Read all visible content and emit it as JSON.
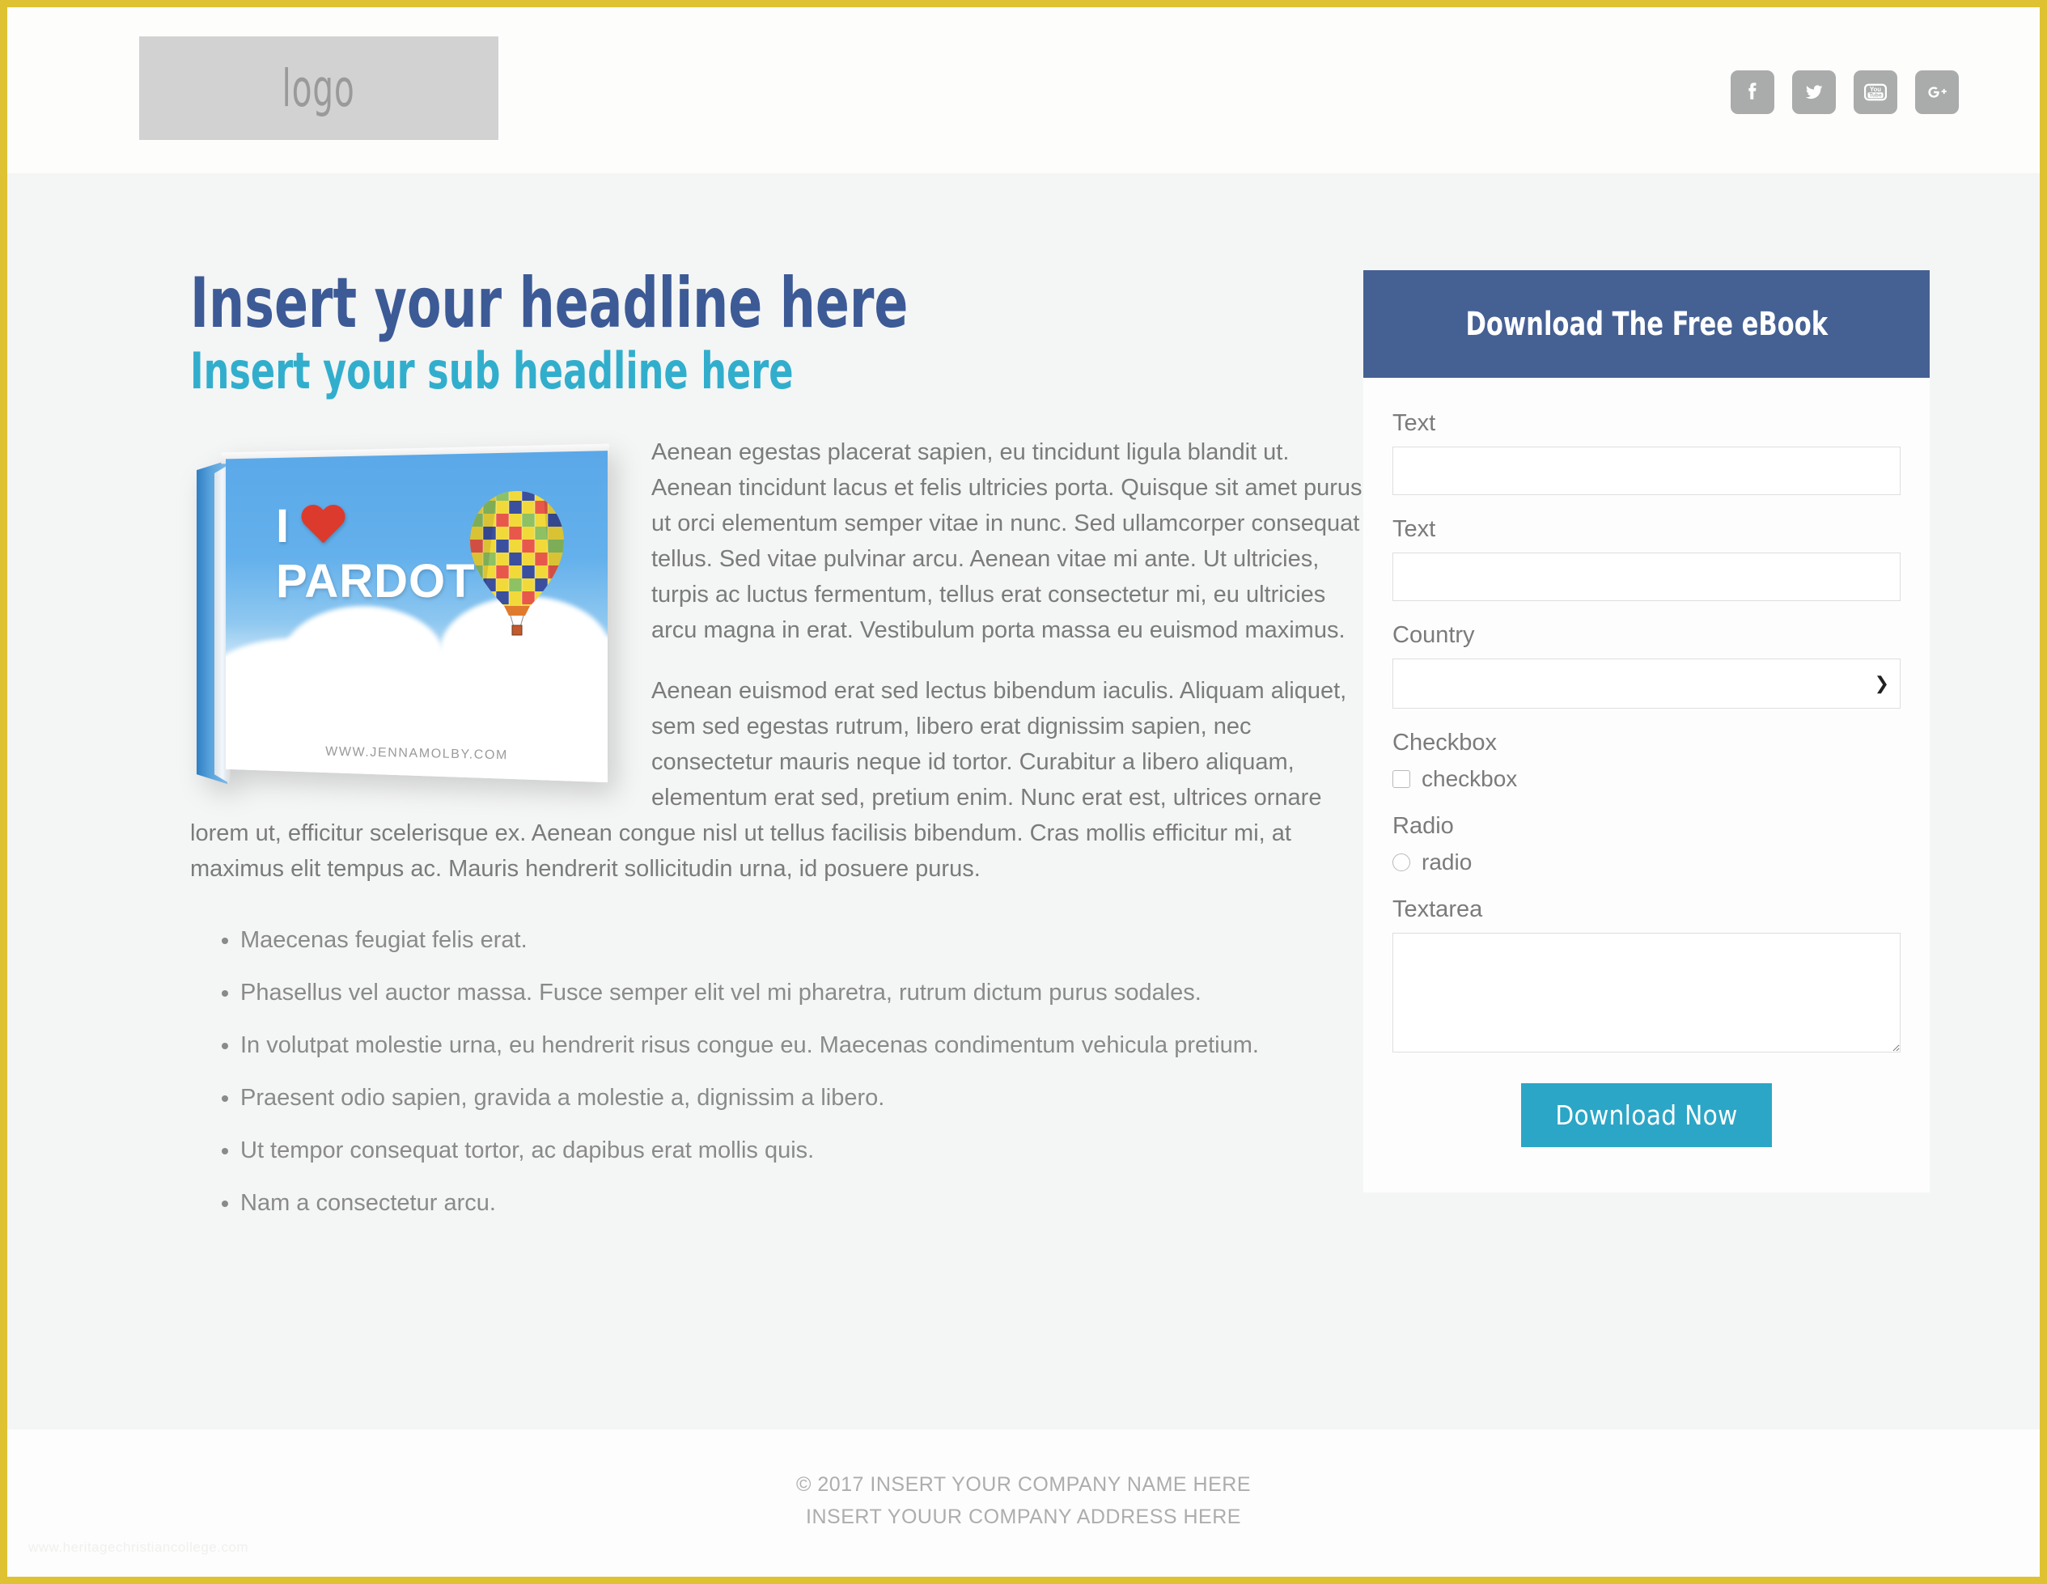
{
  "header": {
    "logo_text": "logo",
    "social": [
      {
        "name": "facebook-icon",
        "label": "Facebook"
      },
      {
        "name": "twitter-icon",
        "label": "Twitter"
      },
      {
        "name": "youtube-icon",
        "label": "YouTube"
      },
      {
        "name": "googleplus-icon",
        "label": "Google Plus"
      }
    ]
  },
  "content": {
    "headline": "Insert your headline here",
    "subheadline": "Insert your sub headline here",
    "book": {
      "title_i": "I",
      "title_main": "PARDOT",
      "url": "WWW.JENNAMOLBY.COM"
    },
    "paragraphs": [
      "Aenean egestas placerat sapien, eu tincidunt ligula blandit ut. Aenean tincidunt lacus et felis ultricies porta. Quisque sit amet purus ut orci elementum semper vitae in nunc. Sed ullamcorper consequat tellus. Sed vitae pulvinar arcu. Aenean vitae mi ante. Ut ultricies, turpis ac luctus fermentum, tellus erat consectetur mi, eu ultricies arcu magna in erat. Vestibulum porta massa eu euismod maximus.",
      "Aenean euismod erat sed lectus bibendum iaculis. Aliquam aliquet, sem sed egestas rutrum, libero erat dignissim sapien, nec consectetur mauris neque id tortor. Curabitur a libero aliquam, elementum erat sed, pretium enim. Nunc erat est, ultrices ornare lorem ut, efficitur scelerisque ex. Aenean congue nisl ut tellus facilisis bibendum. Cras mollis efficitur mi, at maximus elit tempus ac. Mauris hendrerit sollicitudin urna, id posuere purus."
    ],
    "bullets": [
      "Maecenas feugiat felis erat.",
      "Phasellus vel auctor massa. Fusce semper elit vel mi pharetra, rutrum dictum purus sodales.",
      "In volutpat molestie urna, eu hendrerit risus congue eu. Maecenas condimentum vehicula pretium.",
      "Praesent odio sapien, gravida a molestie a, dignissim a libero.",
      "Ut tempor consequat tortor, ac dapibus erat mollis quis.",
      "Nam a consectetur arcu."
    ]
  },
  "form": {
    "title": "Download The Free eBook",
    "fields": {
      "text1_label": "Text",
      "text1_value": "",
      "text2_label": "Text",
      "text2_value": "",
      "country_label": "Country",
      "country_value": "",
      "checkbox_label": "Checkbox",
      "checkbox_option": "checkbox",
      "radio_label": "Radio",
      "radio_option": "radio",
      "textarea_label": "Textarea",
      "textarea_value": ""
    },
    "submit_label": "Download Now"
  },
  "footer": {
    "line1": "© 2017 INSERT YOUR COMPANY NAME HERE",
    "line2": "INSERT YOUUR COMPANY ADDRESS HERE",
    "watermark": "www.heritagechristiancollege.com"
  },
  "colors": {
    "page_border": "#dfc232",
    "headline": "#3c5a96",
    "subheadline": "#32aecd",
    "form_header": "#456093",
    "submit_button": "#2ba6c6",
    "body_background": "#f4f5f5"
  }
}
